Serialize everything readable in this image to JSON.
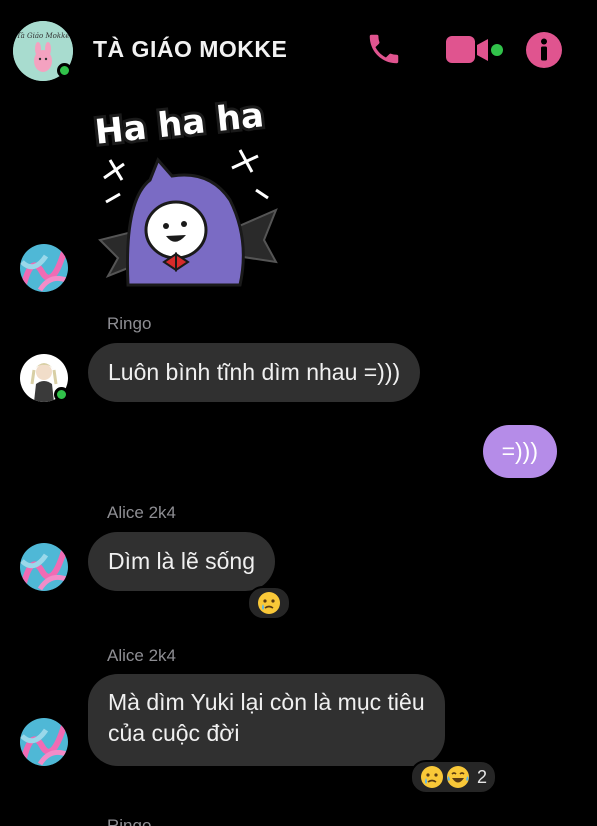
{
  "header": {
    "group_name": "TÀ GIÁO MOKKE",
    "avatar_text": "Tà Giáo Mokke",
    "icons": [
      "phone-icon",
      "video-call-icon",
      "info-icon"
    ],
    "accent_color": "#e0548f",
    "online_color": "#31c24a"
  },
  "sticker": {
    "text": "Ha ha ha"
  },
  "messages": [
    {
      "sender": "Ringo",
      "text": "Luôn bình tĩnh dìm nhau =)))"
    },
    {
      "sender": "",
      "text": "=)))",
      "own": true
    },
    {
      "sender": "Alice 2k4",
      "text": "Dìm là lẽ sống",
      "reactions": [
        "sad-tear-emoji"
      ]
    },
    {
      "sender": "Alice 2k4",
      "text": "Mà dìm Yuki lại còn là mục tiêu\ncủa cuộc đời",
      "reactions": [
        "sad-tear-emoji",
        "laugh-cry-emoji"
      ],
      "reaction_count": "2"
    },
    {
      "sender": "Ringo"
    }
  ],
  "colors": {
    "own_bubble": "#b58ce8",
    "other_bubble": "#303030"
  }
}
